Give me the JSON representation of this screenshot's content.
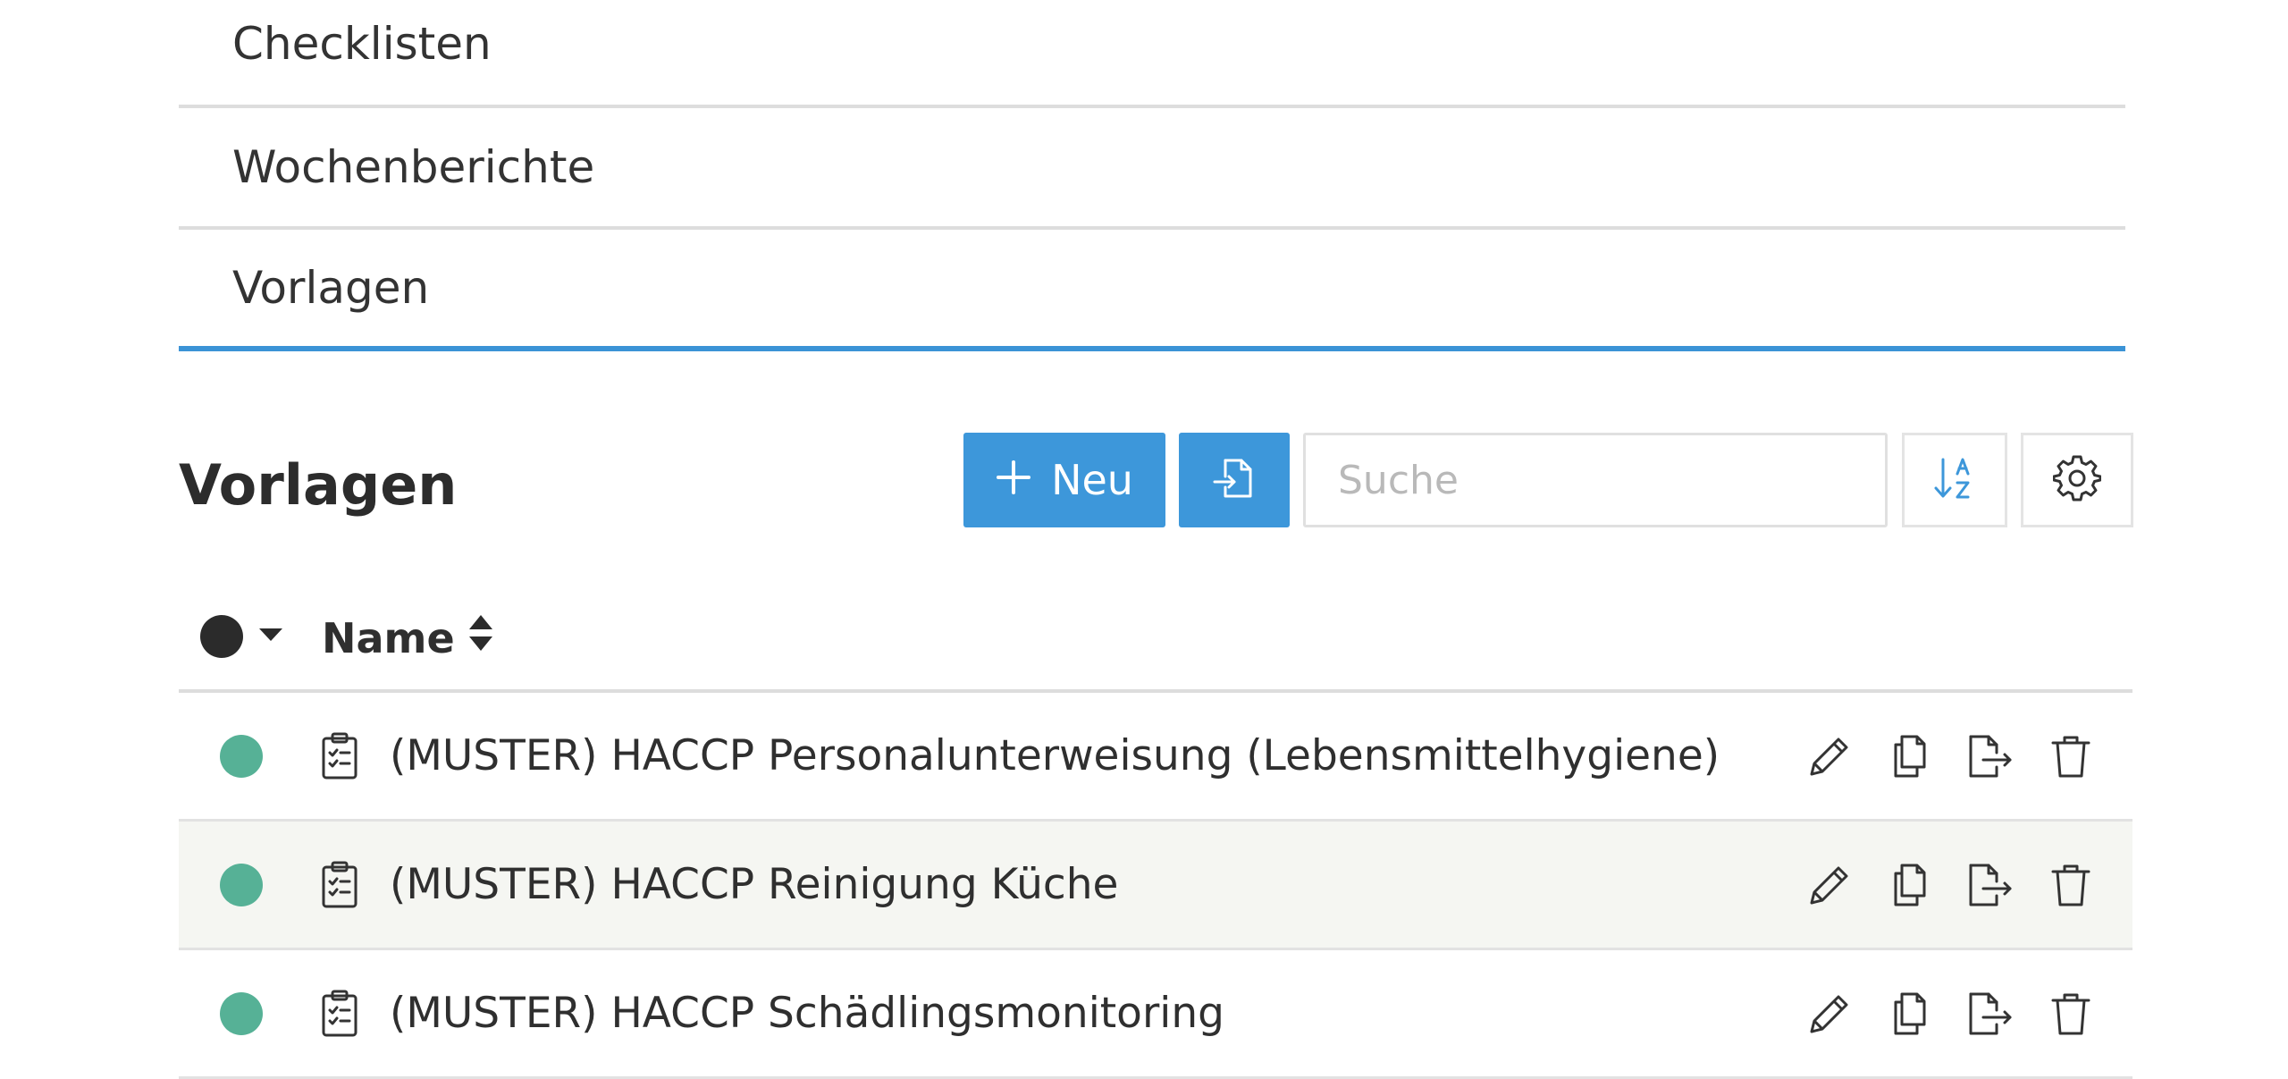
{
  "tabs": [
    {
      "label": "Checklisten",
      "active": false
    },
    {
      "label": "Wochenberichte",
      "active": false
    },
    {
      "label": "Vorlagen",
      "active": true
    }
  ],
  "section": {
    "title": "Vorlagen"
  },
  "toolbar": {
    "new_label": "Neu",
    "search_placeholder": "Suche",
    "accent_color": "#3d97da"
  },
  "table": {
    "name_header": "Name",
    "rows": [
      {
        "name": "(MUSTER) HACCP Personalunterweisung (Lebensmittelhygiene)",
        "status_color": "#56b196"
      },
      {
        "name": "(MUSTER) HACCP Reinigung Küche",
        "status_color": "#56b196"
      },
      {
        "name": "(MUSTER) HACCP Schädlingsmonitoring",
        "status_color": "#56b196"
      }
    ]
  }
}
